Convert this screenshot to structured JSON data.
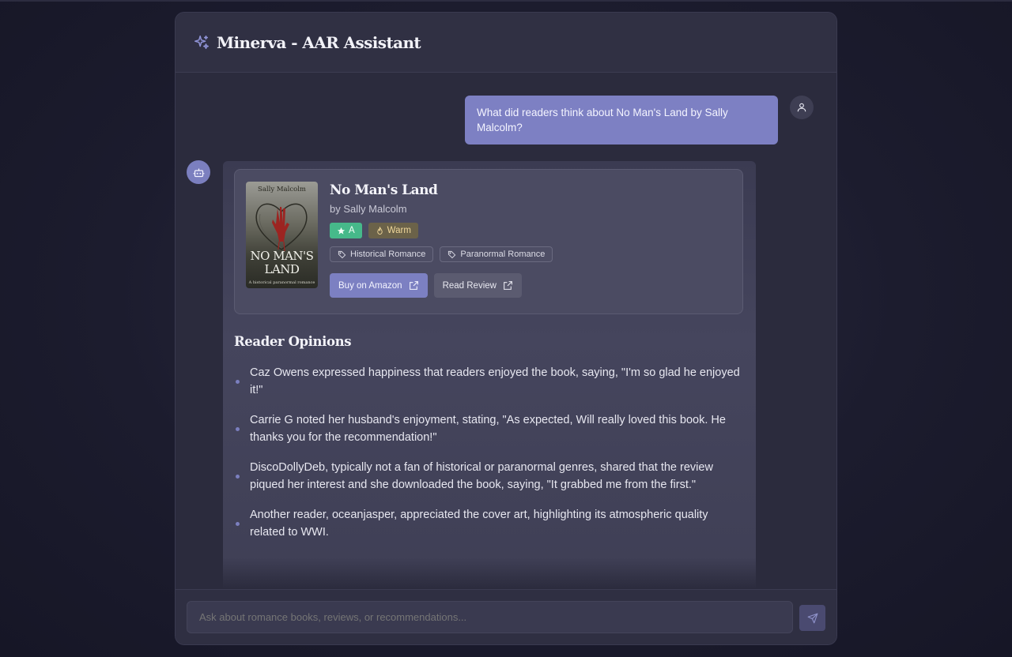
{
  "app": {
    "title": "Minerva - AAR Assistant",
    "icon": "sparkles-icon"
  },
  "colors": {
    "accent": "#7d80c3",
    "grade_green": "#46b98a",
    "heat_tan": "#6b6249"
  },
  "user_message": {
    "text": "What did readers think about No Man's Land by Sally Malcolm?",
    "avatar_icon": "user-icon"
  },
  "bot_message": {
    "avatar_icon": "bot-icon",
    "book": {
      "cover_author": "Sally Malcolm",
      "cover_title": "NO MAN'S LAND",
      "cover_subtitle": "A historical paranormal romance",
      "title": "No Man's Land",
      "author": "by Sally Malcolm",
      "grade": "A",
      "heat": "Warm",
      "tags": [
        "Historical Romance",
        "Paranormal Romance"
      ],
      "buy_label": "Buy on Amazon",
      "review_label": "Read Review"
    },
    "section_title": "Reader Opinions",
    "opinions": [
      "Caz Owens expressed happiness that readers enjoyed the book, saying, \"I'm so glad he enjoyed it!\"",
      "Carrie G noted her husband's enjoyment, stating, \"As expected, Will really loved this book. He thanks you for the recommendation!\"",
      "DiscoDollyDeb, typically not a fan of historical or paranormal genres, shared that the review piqued her interest and she downloaded the book, saying, \"It grabbed me from the first.\"",
      "Another reader, oceanjasper, appreciated the cover art, highlighting its atmospheric quality related to WWI."
    ]
  },
  "composer": {
    "placeholder": "Ask about romance books, reviews, or recommendations...",
    "send_icon": "send-icon"
  }
}
